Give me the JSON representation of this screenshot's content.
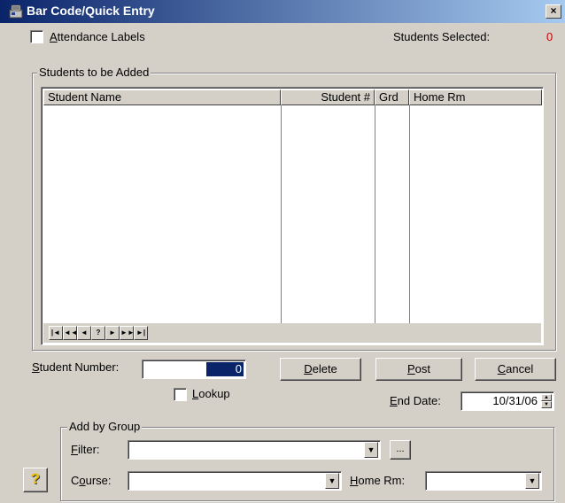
{
  "window": {
    "title": "Bar Code/Quick Entry",
    "close_glyph": "×"
  },
  "attendance_labels": {
    "label_first": "A",
    "label_rest": "ttendance Labels",
    "checked": false
  },
  "students_selected": {
    "label": "Students Selected:",
    "count": "0",
    "count_color": "#cc0000"
  },
  "students_group": {
    "label": "Students to be Added"
  },
  "grid": {
    "columns": [
      "Student Name",
      "Student #",
      "Grd",
      "Home Rm"
    ],
    "rows": [],
    "nav_buttons": [
      "|◄",
      "◄◄",
      "◄",
      "?",
      "►",
      "►►",
      "►|"
    ]
  },
  "student_number": {
    "label_first": "S",
    "label_rest": "tudent Number:",
    "value": "0"
  },
  "lookup": {
    "label_first": "L",
    "label_rest": "ookup",
    "checked": false
  },
  "buttons": {
    "delete": {
      "first": "D",
      "rest": "elete"
    },
    "post": {
      "first": "P",
      "rest": "ost"
    },
    "cancel": {
      "first": "C",
      "rest": "ancel"
    }
  },
  "end_date": {
    "label_first": "E",
    "label_rest": "nd Date:",
    "value": "10/31/06"
  },
  "add_by_group": {
    "label": "Add by Group",
    "filter": {
      "label_first": "F",
      "label_rest": "ilter:",
      "value": "",
      "ellipsis": "..."
    },
    "course": {
      "label_pre": "C",
      "label_u": "o",
      "label_rest": "urse:",
      "value": ""
    },
    "home_rm": {
      "label_first": "H",
      "label_rest": "ome Rm:",
      "value": ""
    }
  },
  "help_button": {
    "glyph": "?"
  },
  "icons": {
    "title": "barcode-app-icon",
    "help": "help-icon"
  }
}
